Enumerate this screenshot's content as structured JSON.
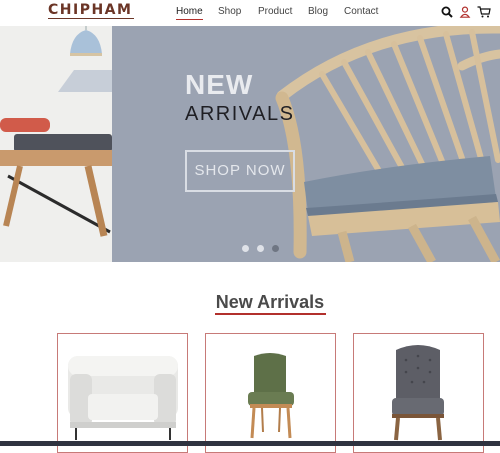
{
  "header": {
    "logo": "CHIPHAM",
    "nav": [
      "Home",
      "Shop",
      "Product",
      "Blog",
      "Contact"
    ],
    "active_nav": "Home",
    "icons": [
      "search-icon",
      "user-icon",
      "cart-icon"
    ]
  },
  "hero": {
    "title_line1": "NEW",
    "title_line2": "ARRIVALS",
    "button": "SHOP NOW",
    "slide_count": 3,
    "active_slide": 3
  },
  "section": {
    "title": "New Arrivals"
  },
  "products": [
    {
      "name": "white-armchair"
    },
    {
      "name": "green-chair"
    },
    {
      "name": "grey-tufted-chair"
    }
  ],
  "colors": {
    "brand": "#6b3526",
    "accent": "#b2302c",
    "hero_bg": "#9aa2b1"
  }
}
